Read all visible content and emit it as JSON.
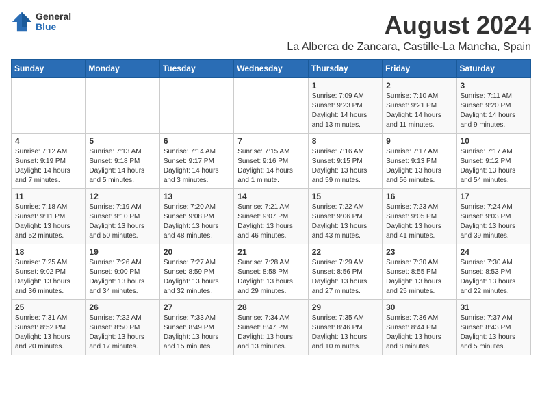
{
  "header": {
    "logo": {
      "general": "General",
      "blue": "Blue"
    },
    "title": "August 2024",
    "subtitle": "La Alberca de Zancara, Castille-La Mancha, Spain"
  },
  "calendar": {
    "headers": [
      "Sunday",
      "Monday",
      "Tuesday",
      "Wednesday",
      "Thursday",
      "Friday",
      "Saturday"
    ],
    "rows": [
      [
        {
          "day": "",
          "info": ""
        },
        {
          "day": "",
          "info": ""
        },
        {
          "day": "",
          "info": ""
        },
        {
          "day": "",
          "info": ""
        },
        {
          "day": "1",
          "info": "Sunrise: 7:09 AM\nSunset: 9:23 PM\nDaylight: 14 hours\nand 13 minutes."
        },
        {
          "day": "2",
          "info": "Sunrise: 7:10 AM\nSunset: 9:21 PM\nDaylight: 14 hours\nand 11 minutes."
        },
        {
          "day": "3",
          "info": "Sunrise: 7:11 AM\nSunset: 9:20 PM\nDaylight: 14 hours\nand 9 minutes."
        }
      ],
      [
        {
          "day": "4",
          "info": "Sunrise: 7:12 AM\nSunset: 9:19 PM\nDaylight: 14 hours\nand 7 minutes."
        },
        {
          "day": "5",
          "info": "Sunrise: 7:13 AM\nSunset: 9:18 PM\nDaylight: 14 hours\nand 5 minutes."
        },
        {
          "day": "6",
          "info": "Sunrise: 7:14 AM\nSunset: 9:17 PM\nDaylight: 14 hours\nand 3 minutes."
        },
        {
          "day": "7",
          "info": "Sunrise: 7:15 AM\nSunset: 9:16 PM\nDaylight: 14 hours\nand 1 minute."
        },
        {
          "day": "8",
          "info": "Sunrise: 7:16 AM\nSunset: 9:15 PM\nDaylight: 13 hours\nand 59 minutes."
        },
        {
          "day": "9",
          "info": "Sunrise: 7:17 AM\nSunset: 9:13 PM\nDaylight: 13 hours\nand 56 minutes."
        },
        {
          "day": "10",
          "info": "Sunrise: 7:17 AM\nSunset: 9:12 PM\nDaylight: 13 hours\nand 54 minutes."
        }
      ],
      [
        {
          "day": "11",
          "info": "Sunrise: 7:18 AM\nSunset: 9:11 PM\nDaylight: 13 hours\nand 52 minutes."
        },
        {
          "day": "12",
          "info": "Sunrise: 7:19 AM\nSunset: 9:10 PM\nDaylight: 13 hours\nand 50 minutes."
        },
        {
          "day": "13",
          "info": "Sunrise: 7:20 AM\nSunset: 9:08 PM\nDaylight: 13 hours\nand 48 minutes."
        },
        {
          "day": "14",
          "info": "Sunrise: 7:21 AM\nSunset: 9:07 PM\nDaylight: 13 hours\nand 46 minutes."
        },
        {
          "day": "15",
          "info": "Sunrise: 7:22 AM\nSunset: 9:06 PM\nDaylight: 13 hours\nand 43 minutes."
        },
        {
          "day": "16",
          "info": "Sunrise: 7:23 AM\nSunset: 9:05 PM\nDaylight: 13 hours\nand 41 minutes."
        },
        {
          "day": "17",
          "info": "Sunrise: 7:24 AM\nSunset: 9:03 PM\nDaylight: 13 hours\nand 39 minutes."
        }
      ],
      [
        {
          "day": "18",
          "info": "Sunrise: 7:25 AM\nSunset: 9:02 PM\nDaylight: 13 hours\nand 36 minutes."
        },
        {
          "day": "19",
          "info": "Sunrise: 7:26 AM\nSunset: 9:00 PM\nDaylight: 13 hours\nand 34 minutes."
        },
        {
          "day": "20",
          "info": "Sunrise: 7:27 AM\nSunset: 8:59 PM\nDaylight: 13 hours\nand 32 minutes."
        },
        {
          "day": "21",
          "info": "Sunrise: 7:28 AM\nSunset: 8:58 PM\nDaylight: 13 hours\nand 29 minutes."
        },
        {
          "day": "22",
          "info": "Sunrise: 7:29 AM\nSunset: 8:56 PM\nDaylight: 13 hours\nand 27 minutes."
        },
        {
          "day": "23",
          "info": "Sunrise: 7:30 AM\nSunset: 8:55 PM\nDaylight: 13 hours\nand 25 minutes."
        },
        {
          "day": "24",
          "info": "Sunrise: 7:30 AM\nSunset: 8:53 PM\nDaylight: 13 hours\nand 22 minutes."
        }
      ],
      [
        {
          "day": "25",
          "info": "Sunrise: 7:31 AM\nSunset: 8:52 PM\nDaylight: 13 hours\nand 20 minutes."
        },
        {
          "day": "26",
          "info": "Sunrise: 7:32 AM\nSunset: 8:50 PM\nDaylight: 13 hours\nand 17 minutes."
        },
        {
          "day": "27",
          "info": "Sunrise: 7:33 AM\nSunset: 8:49 PM\nDaylight: 13 hours\nand 15 minutes."
        },
        {
          "day": "28",
          "info": "Sunrise: 7:34 AM\nSunset: 8:47 PM\nDaylight: 13 hours\nand 13 minutes."
        },
        {
          "day": "29",
          "info": "Sunrise: 7:35 AM\nSunset: 8:46 PM\nDaylight: 13 hours\nand 10 minutes."
        },
        {
          "day": "30",
          "info": "Sunrise: 7:36 AM\nSunset: 8:44 PM\nDaylight: 13 hours\nand 8 minutes."
        },
        {
          "day": "31",
          "info": "Sunrise: 7:37 AM\nSunset: 8:43 PM\nDaylight: 13 hours\nand 5 minutes."
        }
      ]
    ]
  }
}
